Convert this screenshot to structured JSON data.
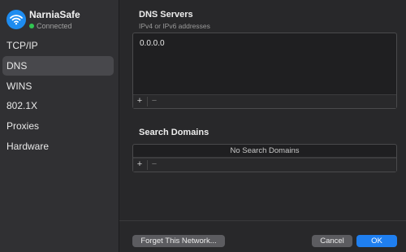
{
  "network": {
    "name": "NarniaSafe",
    "status": "Connected",
    "status_color": "#31c552",
    "icon": "wifi-icon"
  },
  "sidebar": {
    "items": [
      {
        "label": "TCP/IP",
        "selected": false
      },
      {
        "label": "DNS",
        "selected": true
      },
      {
        "label": "WINS",
        "selected": false
      },
      {
        "label": "802.1X",
        "selected": false
      },
      {
        "label": "Proxies",
        "selected": false
      },
      {
        "label": "Hardware",
        "selected": false
      }
    ]
  },
  "dns_servers": {
    "title": "DNS Servers",
    "subtitle": "IPv4 or IPv6 addresses",
    "entries": [
      "0.0.0.0"
    ],
    "add_label": "+",
    "remove_label": "−"
  },
  "search_domains": {
    "title": "Search Domains",
    "empty_message": "No Search Domains",
    "add_label": "+",
    "remove_label": "−"
  },
  "footer": {
    "forget_label": "Forget This Network...",
    "cancel_label": "Cancel",
    "ok_label": "OK"
  },
  "colors": {
    "accent": "#1f7ff0"
  }
}
